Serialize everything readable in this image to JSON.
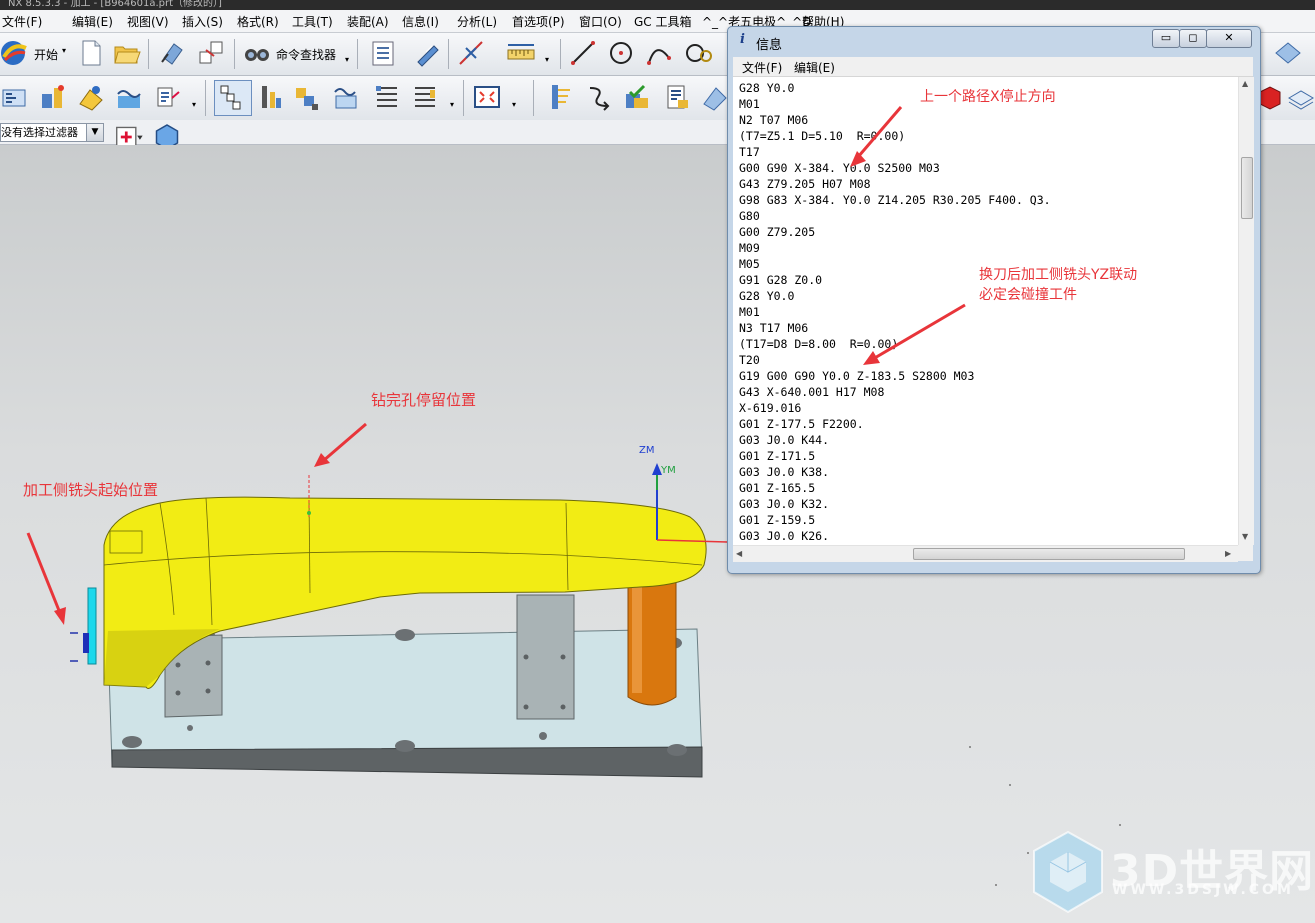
{
  "app": {
    "title_fragment": "NX 8.5.3.3 - 加工 - [B964601a.prt（修改的）]"
  },
  "menubar": {
    "items": [
      "文件(F)",
      "编辑(E)",
      "视图(V)",
      "插入(S)",
      "格式(R)",
      "工具(T)",
      "装配(A)",
      "信息(I)",
      "分析(L)",
      "首选项(P)",
      "窗口(O)",
      "GC 工具箱",
      "^_^老五电极^_^D",
      "帮助(H)"
    ]
  },
  "toolbar": {
    "start_label": "开始",
    "command_finder_label": "命令查找器",
    "filter_value": "没有选择过滤器"
  },
  "annotations": {
    "last_path_stop": "上一个路径X停止方向",
    "tool_change_line1": "换刀后加工侧铣头YZ联动",
    "tool_change_line2": "必定会碰撞工件",
    "drill_stop": "钻完孔停留位置",
    "side_head_start": "加工侧铣头起始位置"
  },
  "axis": {
    "zm": "ZM",
    "ym": "YM"
  },
  "info_window": {
    "title": "信息",
    "menu_file": "文件(F)",
    "menu_edit": "编辑(E)",
    "lines": [
      "G28 Y0.0",
      "M01",
      "N2 T07 M06",
      "(T7=Z5.1 D=5.10  R=0.00)",
      "T17",
      "G00 G90 X-384. Y0.0 S2500 M03",
      "G43 Z79.205 H07 M08",
      "G98 G83 X-384. Y0.0 Z14.205 R30.205 F400. Q3.",
      "G80",
      "G00 Z79.205",
      "M09",
      "M05",
      "G91 G28 Z0.0",
      "G28 Y0.0",
      "M01",
      "N3 T17 M06",
      "(T17=D8 D=8.00  R=0.00)",
      "T20",
      "G19 G00 G90 Y0.0 Z-183.5 S2800 M03",
      "G43 X-640.001 H17 M08",
      "X-619.016",
      "G01 Z-177.5 F2200.",
      "G03 J0.0 K44.",
      "G01 Z-171.5",
      "G03 J0.0 K38.",
      "G01 Z-165.5",
      "G03 J0.0 K32.",
      "G01 Z-159.5",
      "G03 J0.0 K26."
    ]
  },
  "watermark": {
    "brand": "3D世界网",
    "url": "WWW.3DSJW.COM"
  },
  "colors": {
    "annotation_red": "#e8353a",
    "part_yellow": "#f2ec14",
    "pillar_orange": "#d9770e",
    "fixture_plate": "#c9dde1"
  }
}
